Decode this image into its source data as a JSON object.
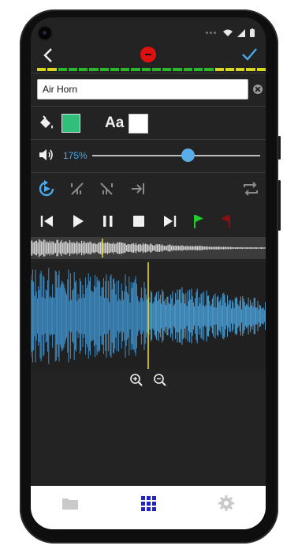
{
  "topbar": {
    "back_icon": "chevron-left-icon",
    "record_icon": "record-minus-icon",
    "confirm_icon": "checkmark-icon"
  },
  "level_meter": {
    "colors": [
      "#2ab82a",
      "#d6d61e"
    ]
  },
  "name_field": {
    "value": "Air Horn"
  },
  "style_row": {
    "fill_icon": "paint-bucket-icon",
    "fill_color": "#2fbf7a",
    "text_label": "Aa",
    "text_color": "#ffffff"
  },
  "volume": {
    "value_text": "175%",
    "level": 0.58
  },
  "tools": [
    "replay-icon",
    "fade-in-icon",
    "fade-out-icon",
    "skip-to-end-icon",
    "repeat-icon"
  ],
  "transport": [
    "skip-back-icon",
    "play-icon",
    "pause-icon",
    "stop-icon",
    "skip-forward-icon",
    "start-marker-flag-icon",
    "end-marker-flag-icon"
  ],
  "colors": {
    "accent": "#4aa8e8",
    "waveform": "#3f8fc8",
    "playhead": "#e8d820",
    "green_flag": "#1fcc2a",
    "red_flag": "#8a1010"
  },
  "zoom": [
    "zoom-in-icon",
    "zoom-out-icon"
  ],
  "bottom_nav": [
    {
      "icon": "folder-icon",
      "active": false
    },
    {
      "icon": "grid-icon",
      "active": true
    },
    {
      "icon": "gear-icon",
      "active": false
    }
  ]
}
